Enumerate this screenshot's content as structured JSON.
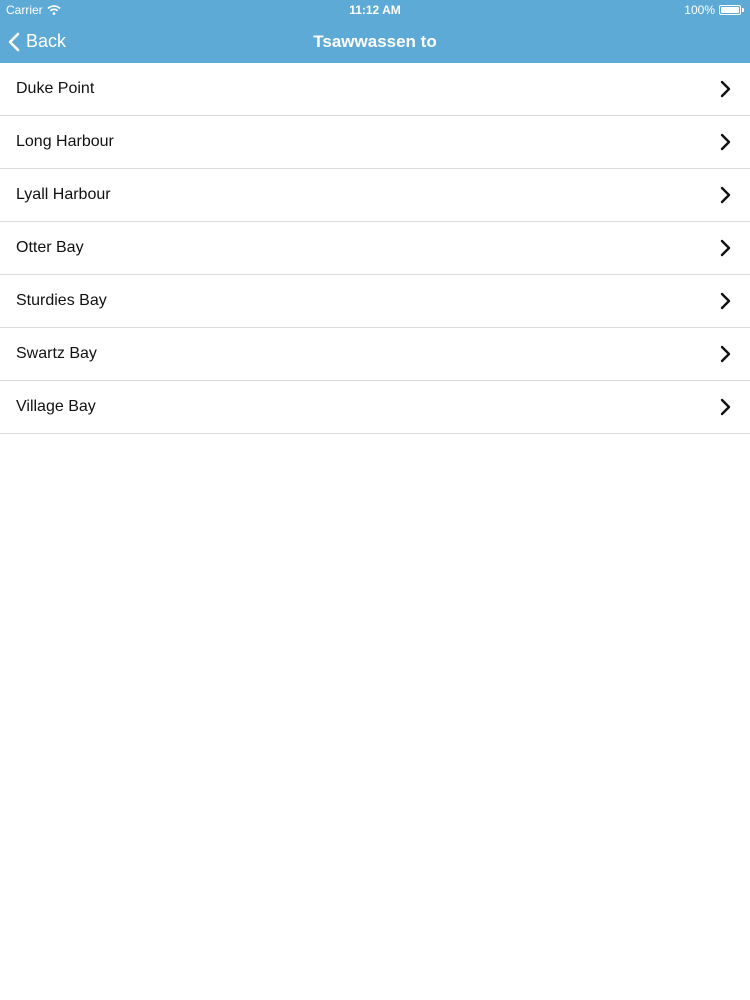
{
  "status_bar": {
    "carrier": "Carrier",
    "time": "11:12 AM",
    "battery": "100%"
  },
  "nav": {
    "back_label": "Back",
    "title": "Tsawwassen to"
  },
  "destinations": [
    "Duke Point",
    "Long Harbour",
    "Lyall Harbour",
    "Otter Bay",
    "Sturdies Bay",
    "Swartz Bay",
    "Village Bay"
  ],
  "icons": {
    "back": "chevron-left-icon",
    "row": "chevron-right-icon",
    "wifi": "wifi-icon",
    "battery": "battery-icon"
  },
  "colors": {
    "header": "#5eaad6",
    "separator": "#dcdcdc"
  }
}
